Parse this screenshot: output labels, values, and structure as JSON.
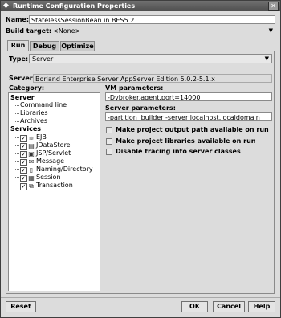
{
  "window": {
    "title": "Runtime Configuration Properties",
    "close_glyph": "✕"
  },
  "name": {
    "label": "Name:",
    "value": "StatelessSessionBean in BES5.2"
  },
  "build_target": {
    "label": "Build target:",
    "value": "<None>"
  },
  "tabs": [
    {
      "label": "Run",
      "active": true
    },
    {
      "label": "Debug",
      "active": false
    },
    {
      "label": "Optimize",
      "active": false
    }
  ],
  "type": {
    "label": "Type:",
    "value": "Server"
  },
  "server": {
    "label": "Server:",
    "value": "Borland Enterprise Server AppServer Edition 5.0.2-5.1.x"
  },
  "category": {
    "label": "Category:",
    "items": [
      {
        "label": "Server",
        "level": 0,
        "checkbox": false
      },
      {
        "label": "Command line",
        "level": 1,
        "checkbox": false
      },
      {
        "label": "Libraries",
        "level": 1,
        "checkbox": false
      },
      {
        "label": "Archives",
        "level": 1,
        "checkbox": false
      },
      {
        "label": "Services",
        "level": 0,
        "checkbox": false
      },
      {
        "label": "EJB",
        "level": 1,
        "checkbox": true,
        "checked": true,
        "icon": "ejb-icon"
      },
      {
        "label": "JDataStore",
        "level": 1,
        "checkbox": true,
        "checked": true,
        "icon": "jdatastore-icon"
      },
      {
        "label": "JSP/Servlet",
        "level": 1,
        "checkbox": true,
        "checked": true,
        "icon": "jsp-servlet-icon"
      },
      {
        "label": "Message",
        "level": 1,
        "checkbox": true,
        "checked": true,
        "icon": "message-icon"
      },
      {
        "label": "Naming/Directory",
        "level": 1,
        "checkbox": true,
        "checked": true,
        "icon": "naming-directory-icon"
      },
      {
        "label": "Session",
        "level": 1,
        "checkbox": true,
        "checked": true,
        "icon": "session-icon"
      },
      {
        "label": "Transaction",
        "level": 1,
        "checkbox": true,
        "checked": true,
        "icon": "transaction-icon"
      }
    ]
  },
  "vm_parameters": {
    "label": "VM parameters:",
    "value": "-Dvbroker.agent.port=14000"
  },
  "server_parameters": {
    "label": "Server parameters:",
    "value": "-partition jbuilder -server localhost.localdomain"
  },
  "options": [
    {
      "label": "Make project output path available on run",
      "checked": false
    },
    {
      "label": "Make project libraries available on run",
      "checked": false
    },
    {
      "label": "Disable tracing into server classes",
      "checked": false
    }
  ],
  "buttons": {
    "reset": "Reset",
    "ok": "OK",
    "cancel": "Cancel",
    "help": "Help"
  }
}
